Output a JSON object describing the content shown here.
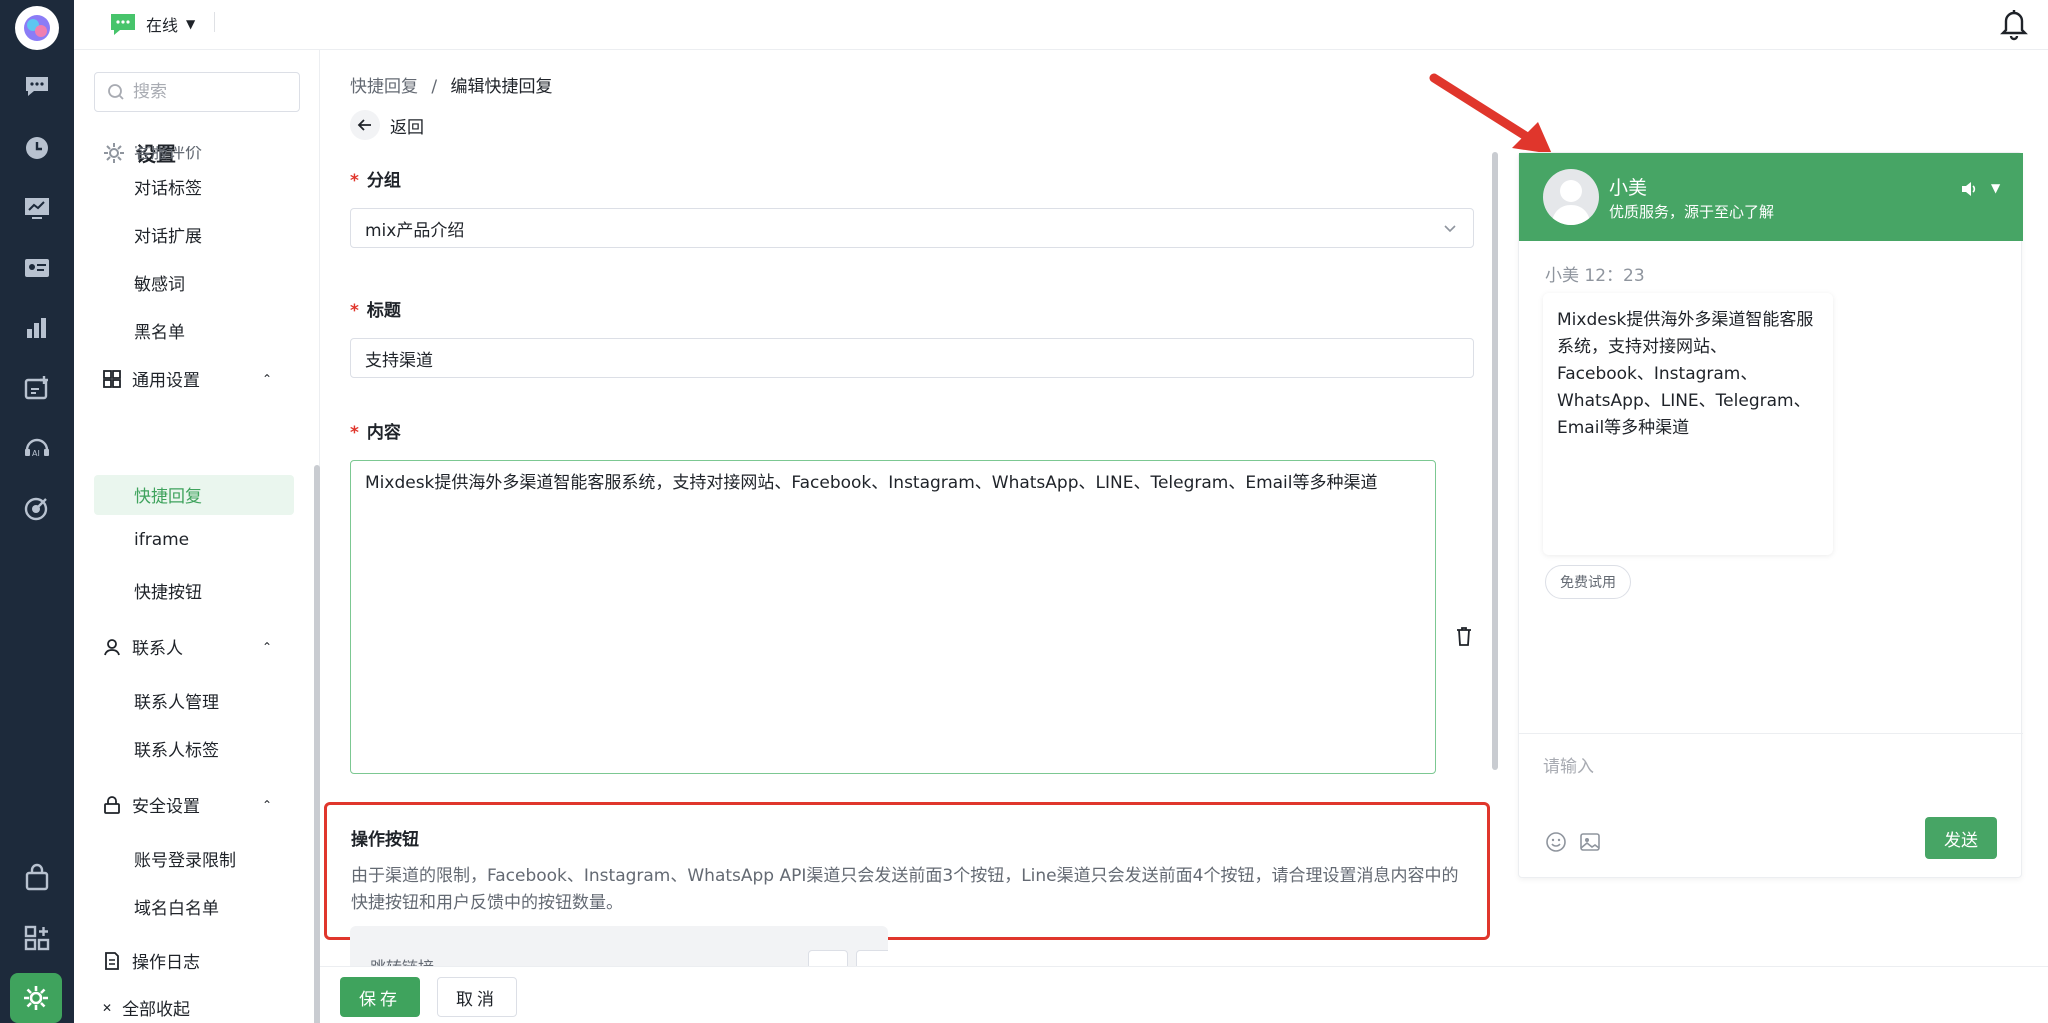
{
  "topbar": {
    "status_label": "在线"
  },
  "sidebar": {
    "search_placeholder": "搜索",
    "settings_title": "设置",
    "items": {
      "csat": "客服评价",
      "conv_tags": "对话标签",
      "conv_ext": "对话扩展",
      "sensitive": "敏感词",
      "blacklist": "黑名单",
      "general": "通用设置",
      "quick_reply": "快捷回复",
      "iframe": "iframe",
      "quick_buttons": "快捷按钮",
      "contacts": "联系人",
      "contact_mgmt": "联系人管理",
      "contact_tags": "联系人标签",
      "security": "安全设置",
      "login_limit": "账号登录限制",
      "domain_whitelist": "域名白名单",
      "op_log": "操作日志",
      "collapse_all": "全部收起"
    }
  },
  "breadcrumb": {
    "parent": "快捷回复",
    "separator": "/",
    "current": "编辑快捷回复"
  },
  "back_label": "返回",
  "form": {
    "required_mark": "*",
    "group_label": "分组",
    "group_value": "mix产品介绍",
    "title_label": "标题",
    "title_value": "支持渠道",
    "content_label": "内容",
    "content_value": "Mixdesk提供海外多渠道智能客服系统，支持对接网站、Facebook、Instagram、WhatsApp、LINE、Telegram、Email等多种渠道",
    "ops_title": "操作按钮",
    "ops_desc": "由于渠道的限制，Facebook、Instagram、WhatsApp API渠道只会发送前面3个按钮，Line渠道只会发送前面4个按钮，请合理设置消息内容中的快捷按钮和用户反馈中的按钮数量。",
    "ops_card_label": "跳转链接"
  },
  "footer": {
    "save": "保存",
    "cancel": "取消"
  },
  "preview": {
    "agent_name": "小美",
    "agent_sub": "优质服务，源于至心了解",
    "meta": "小美 12：23",
    "message": "Mixdesk提供海外多渠道智能客服系统，支持对接网站、Facebook、Instagram、WhatsApp、LINE、Telegram、Email等多种渠道",
    "chip": "免费试用",
    "input_placeholder": "请输入",
    "send": "发送"
  },
  "colors": {
    "brand_green": "#47a565",
    "sidebar_dark": "#1d2a3b",
    "annotation_red": "#e0362c"
  }
}
